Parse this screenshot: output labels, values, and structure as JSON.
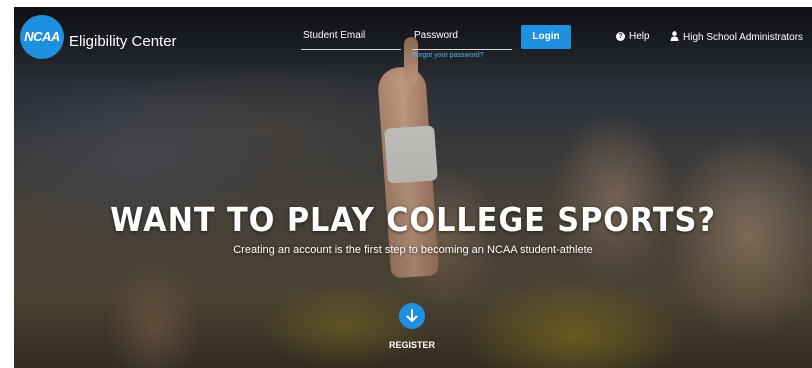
{
  "header": {
    "logo_mark": "NCAA",
    "logo_text": "Eligibility Center",
    "email_label": "Student Email",
    "password_label": "Password",
    "forgot_link": "Forgot your password?",
    "login_label": "Login",
    "help_label": "Help",
    "admin_label": "High School Administrators"
  },
  "hero": {
    "title": "WANT TO PLAY COLLEGE SPORTS?",
    "subtitle": "Creating an account is the first step to becoming an NCAA student-athlete",
    "register_label": "REGISTER"
  },
  "colors": {
    "accent": "#1f8fe0",
    "link": "#5bb0f0"
  },
  "icons": {
    "help": "help-circle-icon",
    "admin": "user-icon",
    "register": "arrow-down-icon"
  }
}
